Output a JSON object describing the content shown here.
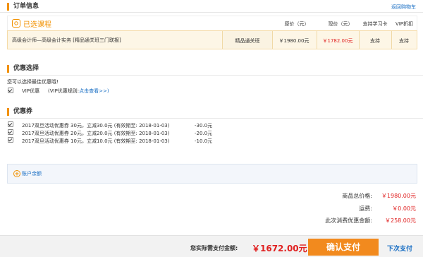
{
  "order": {
    "title": "订单信息",
    "back_link": "返回购物车",
    "selected_label": "已选课程",
    "columns": [
      "原价（元）",
      "现价（元）",
      "支持学习卡",
      "VIP折扣"
    ],
    "course": {
      "name": "高级会计师—高级会计实务 [精品通关班三门联报]",
      "type": "精品通关班",
      "original_price": "￥1980.00元",
      "current_price": "￥1782.00元",
      "study_card": "支持",
      "vip_discount": "支持"
    }
  },
  "discount": {
    "title": "优惠选择",
    "hint": "您可以选择最佳优惠哦!",
    "vip_label": "VIP优惠",
    "vip_rule_prefix": "(VIP优惠规则:",
    "vip_rule_link": "点击查看>>)"
  },
  "coupons": {
    "title": "优惠券",
    "items": [
      {
        "desc": "2017双旦活动优惠券 30元，立减30.0元 (有效期至: 2018-01-03)",
        "amount": "-30.0元"
      },
      {
        "desc": "2017双旦活动优惠券 20元，立减20.0元 (有效期至: 2018-01-03)",
        "amount": "-20.0元"
      },
      {
        "desc": "2017双旦活动优惠券 10元，立减10.0元 (有效期至: 2018-01-03)",
        "amount": "-10.0元"
      }
    ]
  },
  "balance": {
    "label": "账户余额"
  },
  "summary": {
    "total_label": "商品总价格:",
    "total_value": "￥1980.00元",
    "shipping_label": "运费:",
    "shipping_value": "￥0.00元",
    "saved_label": "此次消费优惠金额:",
    "saved_value": "￥258.00元"
  },
  "footer": {
    "pay_label": "您实际需支付金额:",
    "pay_value": "￥1672.00元",
    "confirm_button": "确认支付",
    "later_button": "下次支付"
  },
  "colors": {
    "accent": "#f29100",
    "price_red": "#e02020",
    "link_blue": "#1a6fc4",
    "confirm_bg": "#f28a1e"
  }
}
